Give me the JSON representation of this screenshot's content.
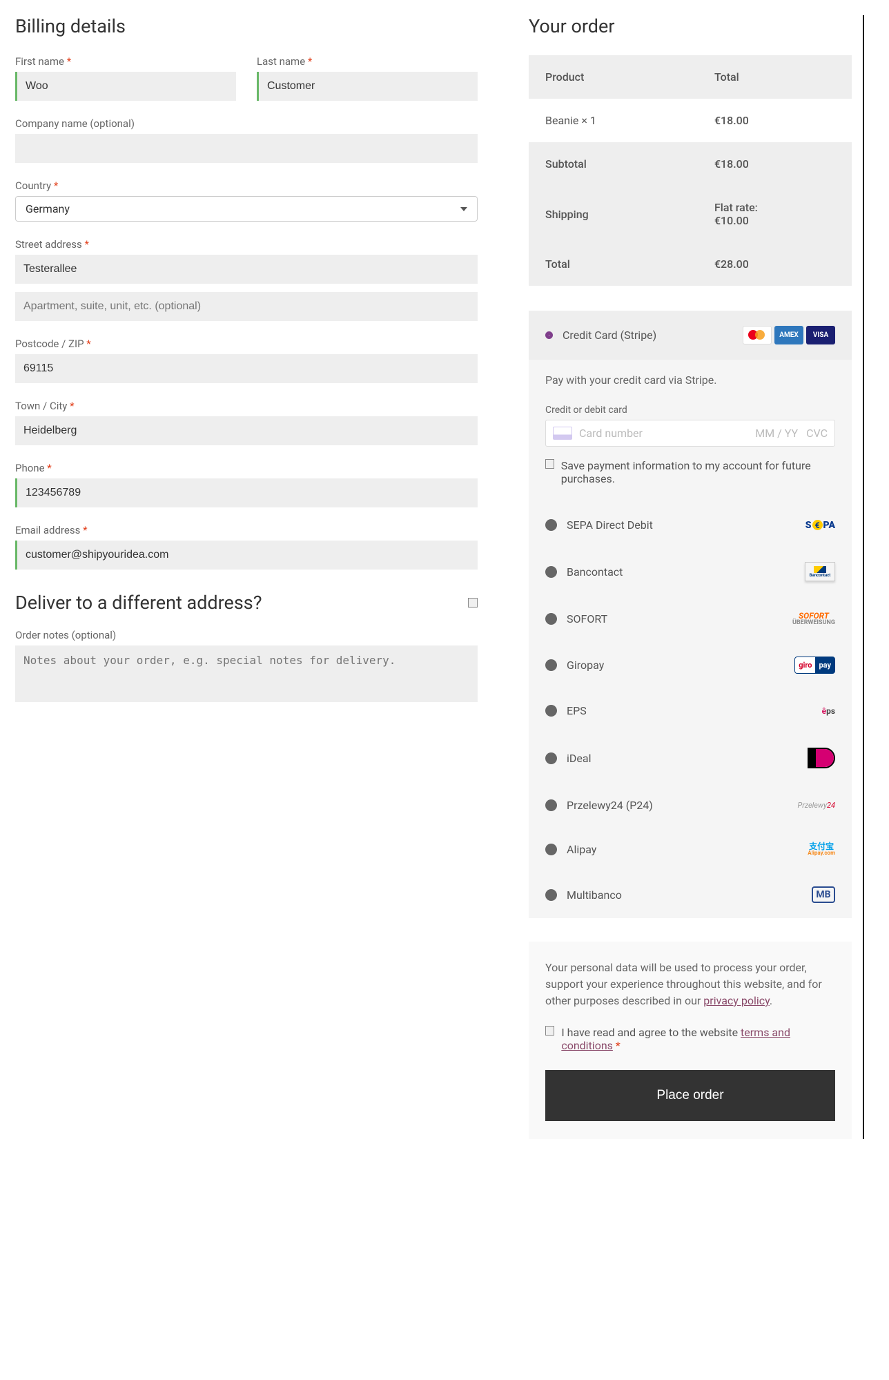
{
  "billing": {
    "title": "Billing details",
    "first_name_label": "First name",
    "first_name_value": "Woo",
    "last_name_label": "Last name",
    "last_name_value": "Customer",
    "company_label": "Company name (optional)",
    "company_value": "",
    "country_label": "Country",
    "country_value": "Germany",
    "street_label": "Street address",
    "street_value": "Testerallee",
    "street2_placeholder": "Apartment, suite, unit, etc. (optional)",
    "postcode_label": "Postcode / ZIP",
    "postcode_value": "69115",
    "city_label": "Town / City",
    "city_value": "Heidelberg",
    "phone_label": "Phone",
    "phone_value": "123456789",
    "email_label": "Email address",
    "email_value": "customer@shipyouridea.com"
  },
  "shipping": {
    "title": "Deliver to a different address?",
    "notes_label": "Order notes (optional)",
    "notes_placeholder": "Notes about your order, e.g. special notes for delivery."
  },
  "order": {
    "title": "Your order",
    "product_header": "Product",
    "total_header": "Total",
    "line_item_name": "Beanie  × 1",
    "line_item_total": "€18.00",
    "subtotal_label": "Subtotal",
    "subtotal_value": "€18.00",
    "shipping_label": "Shipping",
    "shipping_value1": "Flat rate:",
    "shipping_value2": "€10.00",
    "total_label": "Total",
    "total_value": "€28.00"
  },
  "payment": {
    "credit_card_label": "Credit Card (Stripe)",
    "stripe_desc": "Pay with your credit card via Stripe.",
    "card_field_label": "Credit or debit card",
    "card_placeholder_num": "Card number",
    "card_placeholder_exp": "MM / YY",
    "card_placeholder_cvc": "CVC",
    "save_info": "Save payment information to my account for future purchases.",
    "methods": [
      "SEPA Direct Debit",
      "Bancontact",
      "SOFORT",
      "Giropay",
      "EPS",
      "iDeal",
      "Przelewy24 (P24)",
      "Alipay",
      "Multibanco"
    ]
  },
  "footer": {
    "privacy_text_pre": "Your personal data will be used to process your order, support your experience throughout this website, and for other purposes described in our ",
    "privacy_link": "privacy policy",
    "terms_pre": "I have read and agree to the website ",
    "terms_link": "terms and conditions",
    "place_order": "Place order"
  }
}
